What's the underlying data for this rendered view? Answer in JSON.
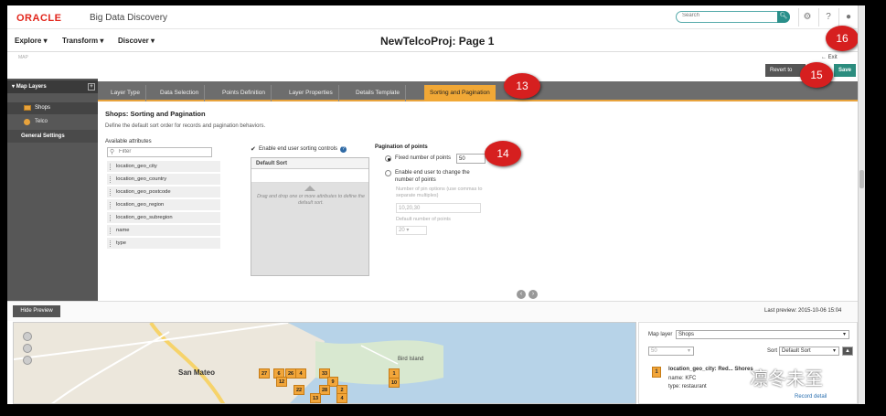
{
  "header": {
    "logo": "ORACLE",
    "app_name": "Big Data Discovery",
    "search_placeholder": "Search"
  },
  "nav": {
    "items": [
      "Explore",
      "Transform",
      "Discover"
    ],
    "page_title": "NewTelcoProj: Page 1",
    "breadcrumb": "MAP",
    "exit": "Exit"
  },
  "actions": {
    "revert": "Revert to",
    "save": "Save"
  },
  "callouts": [
    "16",
    "15",
    "13",
    "14"
  ],
  "left_panel": {
    "header": "Map Layers",
    "layers": [
      "Shops",
      "Telco"
    ],
    "general": "General Settings"
  },
  "tabs": [
    "Layer Type",
    "Data Selection",
    "Points Definition",
    "Layer Properties",
    "Details Template",
    "Sorting and Pagination"
  ],
  "content": {
    "title": "Shops: Sorting and Pagination",
    "description": "Define the default sort order for records and pagination behaviors.",
    "available_label": "Available attributes",
    "filter_placeholder": "Filter",
    "attributes": [
      "location_geo_city",
      "location_geo_country",
      "location_geo_postcode",
      "location_geo_region",
      "location_geo_subregion",
      "name",
      "type"
    ],
    "enable_sort": "Enable end user sorting controls",
    "default_sort": "Default Sort",
    "sort_hint": "Drag and drop one or more attributes to define the default sort.",
    "pagination_title": "Pagination of points",
    "fixed_label": "Fixed number of points",
    "fixed_value": "50",
    "enable_change": "Enable end user to change the number of points",
    "pin_options_label": "Number of pin options (use commas to separate multiples)",
    "pin_options_value": "10,20,30",
    "default_points_label": "Default number of points",
    "default_points_value": "20"
  },
  "preview": {
    "hide_button": "Hide Preview",
    "last_preview": "Last preview: 2015-10-06 15:04"
  },
  "map": {
    "labels": [
      "San Mateo",
      "Bird Island"
    ],
    "markers": [
      "27",
      "6",
      "26",
      "4",
      "33",
      "12",
      "9",
      "22",
      "28",
      "2",
      "13",
      "4",
      "1",
      "10"
    ]
  },
  "side_panel": {
    "map_layer_label": "Map layer",
    "map_layer_value": "Shops",
    "page_size": "50",
    "sort_label": "Sort",
    "sort_value": "Default Sort",
    "record_marker": "1",
    "record_title": "location_geo_city: Red... Shores",
    "record_name": "name: KFC",
    "record_type": "type: restaurant",
    "record_detail": "Record detail"
  },
  "watermark": "凛冬未至"
}
